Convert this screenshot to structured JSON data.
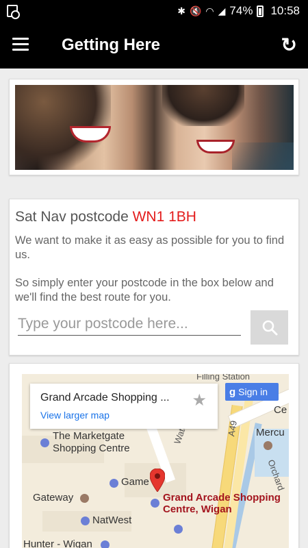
{
  "status_bar": {
    "battery": "74%",
    "time": "10:58"
  },
  "app_bar": {
    "title": "Getting Here"
  },
  "postcode_card": {
    "heading_prefix": "Sat Nav postcode",
    "postcode": "WN1 1BH",
    "paragraph_1": "We want to make it as easy as possible for you to find us.",
    "paragraph_2": "So simply enter your postcode in the box below and we'll find the best route for you.",
    "input_placeholder": "Type your postcode here...",
    "input_value": ""
  },
  "map": {
    "place_name": "Grand Arcade Shopping ...",
    "view_larger_map": "View larger map",
    "sign_in_label": "Sign in",
    "labels": {
      "marketgate_1": "The Marketgate",
      "marketgate_2": "Shopping Centre",
      "game": "Game",
      "gateway": "Gateway",
      "natwest": "NatWest",
      "hunter": "Hunter - Wigan",
      "destination_1": "Grand Arcade Shopping",
      "destination_2": "Centre, Wigan",
      "road_a49": "A49",
      "mercu": "Mercu",
      "orchard": "Orchard",
      "ce": "Ce",
      "filling": "Filling Station",
      "water": "Water"
    }
  }
}
